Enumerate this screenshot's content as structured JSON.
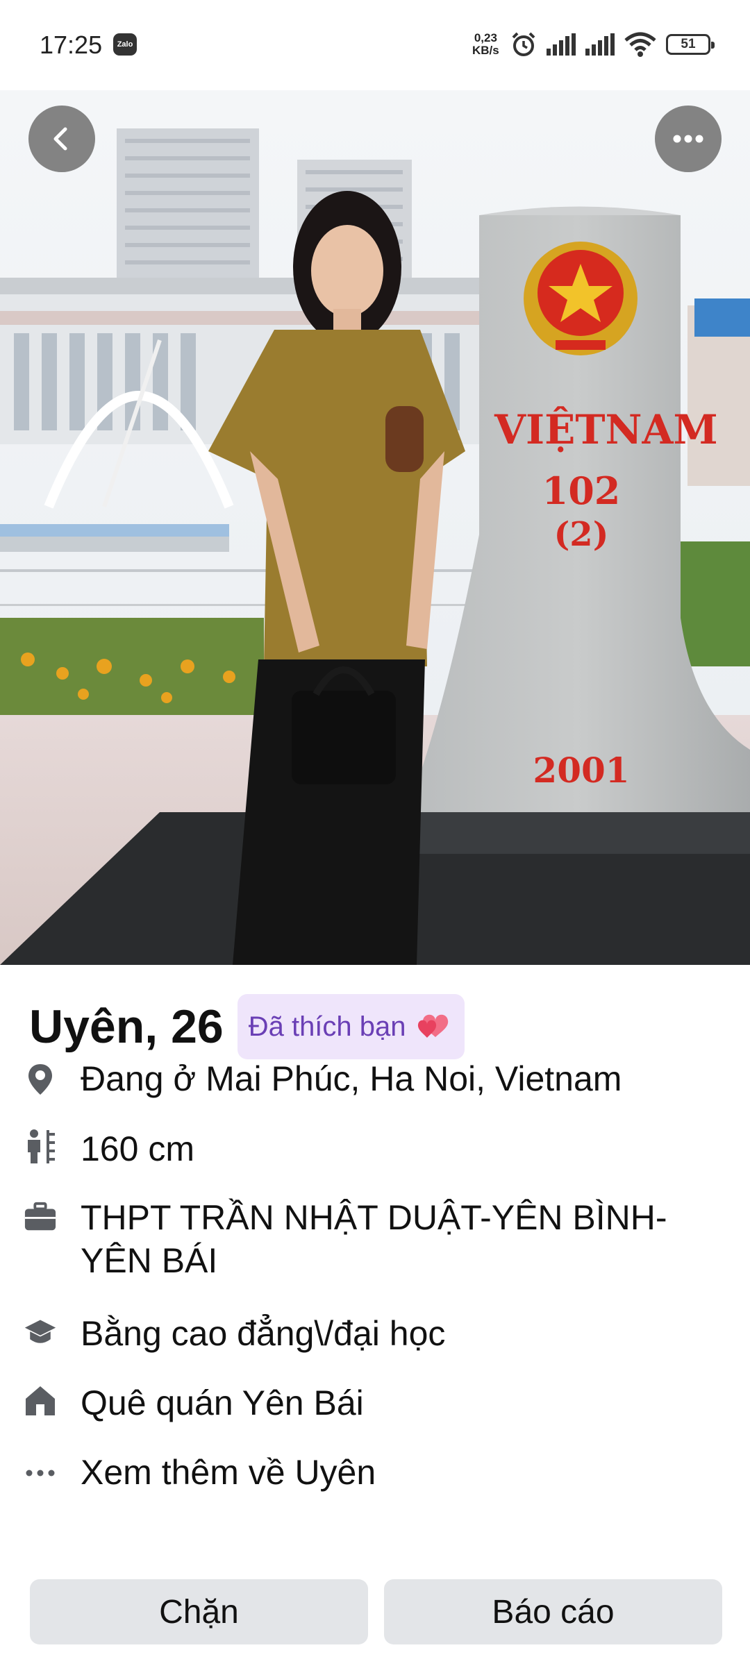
{
  "status_bar": {
    "time": "17:25",
    "app_notification": "Zalo",
    "net_speed_value": "0,23",
    "net_speed_unit": "KB/s",
    "battery": "51"
  },
  "photo": {
    "stone_country": "VIỆTNAM",
    "stone_number": "102",
    "stone_sub": "(2)",
    "stone_year": "2001"
  },
  "profile": {
    "name_age": "Uyên, 26",
    "liked_badge": "Đã thích bạn",
    "details": {
      "location": "Đang ở Mai Phúc, Ha Noi, Vietnam",
      "height": "160 cm",
      "school": "THPT TRẦN NHẬT DUẬT-YÊN BÌNH-YÊN BÁI",
      "education": "Bằng cao đẳng\\/đại học",
      "hometown": "Quê quán Yên Bái",
      "see_more": "Xem thêm về Uyên"
    }
  },
  "actions": {
    "block": "Chặn",
    "report": "Báo cáo"
  },
  "colors": {
    "badge_bg": "#efe5fb",
    "badge_text": "#6a3fb5",
    "button_bg": "#e3e5e8"
  }
}
